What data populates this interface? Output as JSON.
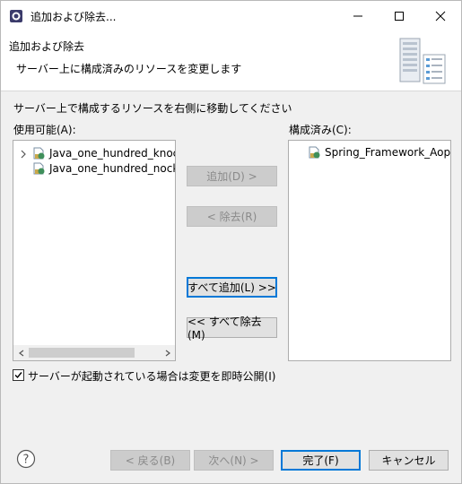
{
  "window": {
    "title": "追加および除去...",
    "controls": [
      "minimize",
      "maximize",
      "close"
    ]
  },
  "header": {
    "title": "追加および除去",
    "description": "サーバー上に構成済みのリソースを変更します"
  },
  "instruction": "サーバー上で構成するリソースを右側に移動してください",
  "available": {
    "label": "使用可能(A):",
    "items": [
      {
        "label": "Java_one_hundred_knock_",
        "expandable": true
      },
      {
        "label": "Java_one_hundred_nock_v",
        "expandable": false
      }
    ]
  },
  "configured": {
    "label": "構成済み(C):",
    "items": [
      {
        "label": "Spring_Framework_Aop"
      }
    ]
  },
  "buttons": {
    "add": "追加(D) >",
    "remove": "< 除去(R)",
    "add_all": "すべて追加(L) >>",
    "remove_all": "<< すべて除去(M)"
  },
  "publish_checkbox": {
    "label": "サーバーが起動されている場合は変更を即時公開(I)",
    "checked": true
  },
  "footer": {
    "back": "< 戻る(B)",
    "next": "次へ(N) >",
    "finish": "完了(F)",
    "cancel": "キャンセル"
  }
}
